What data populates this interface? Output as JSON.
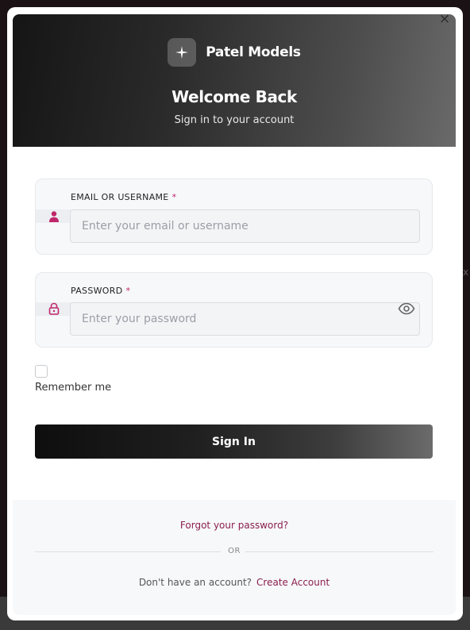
{
  "modal": {
    "close_symbol": "×",
    "header": {
      "brand_name": "Patel Models",
      "logo_icon": "sparkle-icon",
      "title": "Welcome Back",
      "subtitle": "Sign in to your account"
    },
    "form": {
      "email": {
        "label": "EMAIL OR USERNAME",
        "required_mark": "*",
        "placeholder": "Enter your email or username",
        "value": "",
        "icon": "user-icon"
      },
      "password": {
        "label": "PASSWORD",
        "required_mark": "*",
        "placeholder": "Enter your password",
        "value": "",
        "icon": "lock-icon",
        "toggle_icon": "eye-icon"
      },
      "remember_me": {
        "label": "Remember me",
        "checked": false
      },
      "submit_label": "Sign In"
    },
    "footer": {
      "forgot_password": "Forgot your password?",
      "divider_text": "OR",
      "signup_prompt": "Don't have an account?",
      "create_account": "Create Account"
    }
  },
  "colors": {
    "accent": "#c0266a",
    "link": "#8a1f4e",
    "header_gradient_start": "#151515",
    "header_gradient_end": "#6a6a6a"
  }
}
